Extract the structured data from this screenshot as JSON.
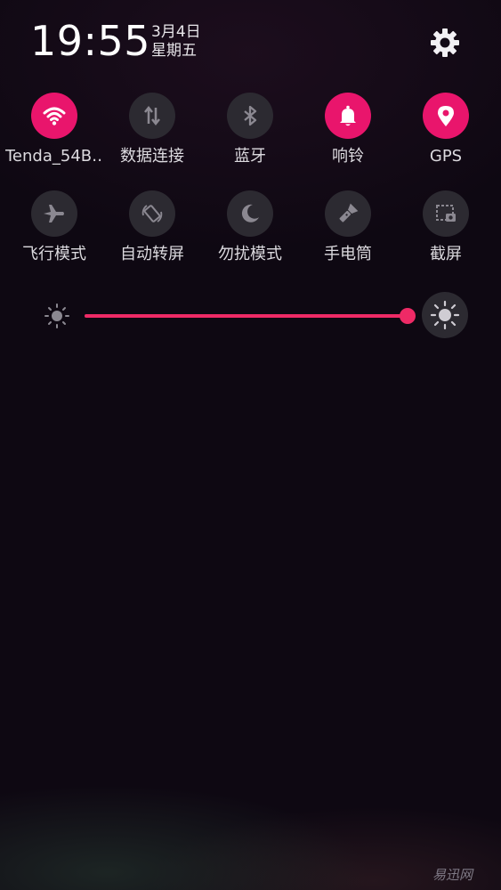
{
  "status": {
    "time": "19:55",
    "date": "3月4日",
    "weekday": "星期五"
  },
  "tiles_row1": [
    {
      "label": "Tenda_54B…",
      "icon": "wifi-icon",
      "active": true
    },
    {
      "label": "数据连接",
      "icon": "data-arrows-icon",
      "active": false
    },
    {
      "label": "蓝牙",
      "icon": "bluetooth-icon",
      "active": false
    },
    {
      "label": "响铃",
      "icon": "bell-icon",
      "active": true
    },
    {
      "label": "GPS",
      "icon": "location-pin-icon",
      "active": true
    }
  ],
  "tiles_row2": [
    {
      "label": "飞行模式",
      "icon": "airplane-icon",
      "active": false
    },
    {
      "label": "自动转屏",
      "icon": "auto-rotate-icon",
      "active": false
    },
    {
      "label": "勿扰模式",
      "icon": "moon-icon",
      "active": false
    },
    {
      "label": "手电筒",
      "icon": "flashlight-icon",
      "active": false
    },
    {
      "label": "截屏",
      "icon": "screenshot-icon",
      "active": false
    }
  ],
  "brightness": {
    "level": 1.0
  },
  "colors": {
    "accent": "#e9156c",
    "inactive": "#2c2a31",
    "background": "#0e0812"
  },
  "watermark": "易迅网"
}
